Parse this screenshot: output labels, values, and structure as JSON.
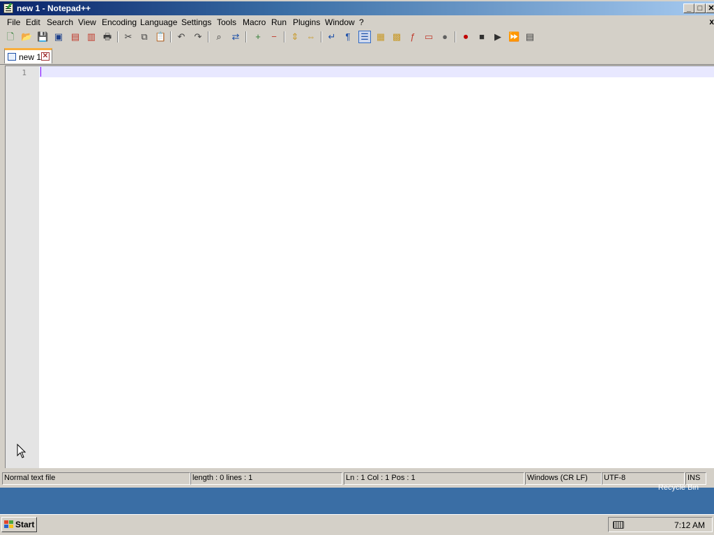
{
  "window": {
    "title": "new 1 - Notepad++"
  },
  "menu": [
    "File",
    "Edit",
    "Search",
    "View",
    "Encoding",
    "Language",
    "Settings",
    "Tools",
    "Macro",
    "Run",
    "Plugins",
    "Window",
    "?"
  ],
  "menu_close": "x",
  "toolbar": {
    "icons": [
      "new-file-icon",
      "open-file-icon",
      "save-icon",
      "save-all-icon",
      "close-icon",
      "close-all-icon",
      "print-icon",
      "cut-icon",
      "copy-icon",
      "paste-icon",
      "undo-icon",
      "redo-icon",
      "find-icon",
      "replace-icon",
      "zoom-in-icon",
      "zoom-out-icon",
      "sync-vertical-icon",
      "sync-horizontal-icon",
      "word-wrap-icon",
      "show-all-chars-icon",
      "indent-guide-icon",
      "user-lang-icon",
      "doc-map-icon",
      "function-list-icon",
      "folder-workspace-icon",
      "monitoring-icon",
      "record-macro-icon",
      "stop-record-icon",
      "play-macro-icon",
      "run-macro-multiple-icon",
      "save-macro-icon"
    ]
  },
  "tab": {
    "label": "new 1",
    "close_glyph": "✕"
  },
  "editor": {
    "line_number": "1"
  },
  "status": {
    "file_type": "Normal text file",
    "length": "length : 0    lines : 1",
    "position": "Ln : 1    Col : 1    Pos : 1",
    "eol": "Windows (CR LF)",
    "encoding": "UTF-8",
    "mode": "INS"
  },
  "desktop": {
    "recycle_bin": "Recycle Bin"
  },
  "taskbar": {
    "start_label": "Start",
    "clock": "7:12 AM"
  }
}
